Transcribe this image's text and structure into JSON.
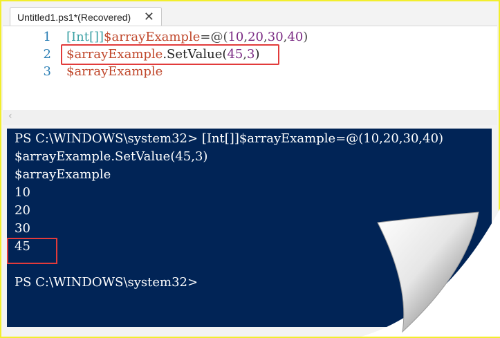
{
  "tab": {
    "title": "Untitled1.ps1*(Recovered)",
    "close_glyph": "✕"
  },
  "editor": {
    "lines": [
      {
        "number": "1",
        "parts": [
          "[Int[]]",
          "$arrayExample",
          "=@(",
          "10",
          ",",
          "20",
          ",",
          "30",
          ",",
          "40",
          ")"
        ]
      },
      {
        "number": "2",
        "parts": [
          "$arrayExample",
          ".SetValue(",
          "45",
          ",",
          "3",
          ")"
        ]
      },
      {
        "number": "3",
        "parts": [
          "$arrayExample"
        ]
      }
    ],
    "scroll_left_glyph": "‹"
  },
  "console": {
    "lines": [
      "PS C:\\WINDOWS\\system32> [Int[]]$arrayExample=@(10,20,30,40)",
      "$arrayExample.SetValue(45,3)",
      "$arrayExample",
      "10",
      "20",
      "30",
      "45",
      "",
      "PS C:\\WINDOWS\\system32>"
    ]
  },
  "colors": {
    "console_bg": "#012456",
    "highlight_box": "#e23b3b",
    "frame_border": "#f2ee2c"
  }
}
